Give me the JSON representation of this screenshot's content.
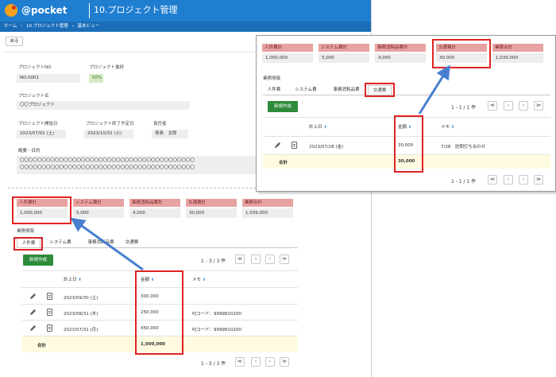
{
  "app": {
    "logo_text": "@pocket",
    "page_title": "10.プロジェクト管理",
    "breadcrumb": [
      "ホーム",
      "›",
      "10.プロジェクト管理",
      "›",
      "基本ビュー"
    ],
    "back_label": "戻る"
  },
  "project": {
    "no_label": "プロジェクトNO",
    "no_value": "NO.0001",
    "progress_label": "プロジェクト進捗",
    "progress_value": "50%",
    "name_label": "プロジェクト名",
    "name_value": "〇〇プロジェクト",
    "start_label": "プロジェクト開始日",
    "start_value": "2023/07/01 (土)",
    "end_label": "プロジェクト終了予定日",
    "end_value": "2023/10/31 (火)",
    "owner_label": "責任者",
    "owner_value": "青島　太郎",
    "summary_label": "概要・目的",
    "summary_line1": "〇〇〇〇〇〇〇〇〇〇〇〇〇〇〇〇〇〇〇〇〇〇〇〇〇〇〇〇〇〇〇〇〇〇〇〇〇〇〇〇",
    "summary_line2": "〇〇〇〇〇〇〇〇〇〇〇〇〇〇〇〇〇〇〇〇〇〇〇〇〇〇〇〇〇〇〇〇〇〇〇〇〇〇〇〇"
  },
  "totals": [
    {
      "label": "人件費計",
      "value": "1,000,000"
    },
    {
      "label": "システム費計",
      "value": "5,000"
    },
    {
      "label": "事務消耗品費計",
      "value": "4,000"
    },
    {
      "label": "交通費計",
      "value": "30,000"
    },
    {
      "label": "業務合計",
      "value": "1,039,000"
    }
  ],
  "section_label": "業務情報",
  "tabs": [
    "人件費",
    "システム費",
    "事務消耗品費",
    "交通費"
  ],
  "new_button": "新規作成",
  "table_headers": {
    "date": "計上日",
    "amount": "金額",
    "memo": "メモ"
  },
  "total_label": "合計",
  "main_table": {
    "pager_top": "1 - 3 / 3 件",
    "pager_bottom": "1 - 3 / 3 件",
    "rows": [
      {
        "date": "2023/09/30 (土)",
        "amount": "300,000",
        "memo": ""
      },
      {
        "date": "2023/08/31 (木)",
        "amount": "250,000",
        "memo": "PJコード：9999810200"
      },
      {
        "date": "2023/07/31 (月)",
        "amount": "450,000",
        "memo": "PJコード：9999810200"
      }
    ],
    "total": "1,000,000"
  },
  "panel_table": {
    "pager_top": "1 - 1 / 1 件",
    "pager_bottom": "1 - 1 / 1 件",
    "rows": [
      {
        "date": "2023/07/28 (金)",
        "amount": "30,000",
        "memo": "7/28　訪問打ち合わせ"
      }
    ],
    "total": "30,000"
  },
  "pager_icons": {
    "first": "≪",
    "prev": "‹",
    "next": "›",
    "last": "≫"
  },
  "sort_icon": "⬍",
  "colors": {
    "header_blue": "#1f7ed0",
    "accent_red": "#e02222",
    "arrow_blue": "#4a7fd0",
    "new_button_green": "#2e8b3b",
    "total_head_pink": "#e7a2a2",
    "total_row_yellow": "#fffbe0"
  }
}
